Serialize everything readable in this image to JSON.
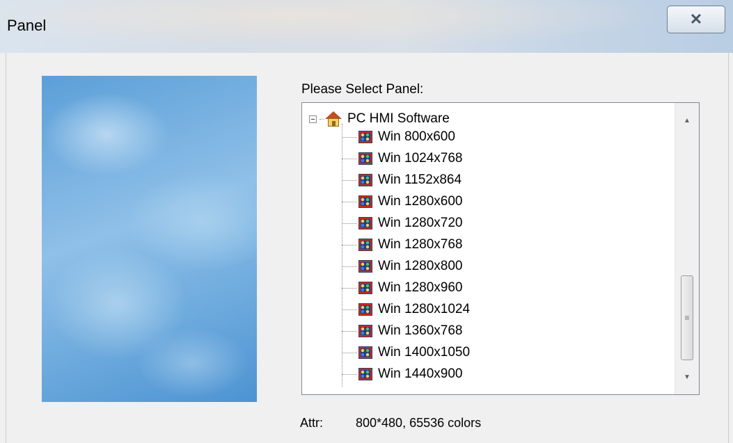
{
  "window": {
    "title": "Panel",
    "close_glyph": "✕"
  },
  "prompt": "Please Select Panel:",
  "tree": {
    "root": {
      "label": "PC HMI Software",
      "icon": "home-icon",
      "expander": "−"
    },
    "items": [
      {
        "label": "Win 800x600"
      },
      {
        "label": "Win 1024x768"
      },
      {
        "label": "Win 1152x864"
      },
      {
        "label": "Win 1280x600"
      },
      {
        "label": "Win 1280x720"
      },
      {
        "label": "Win 1280x768"
      },
      {
        "label": "Win 1280x800"
      },
      {
        "label": "Win 1280x960"
      },
      {
        "label": "Win 1280x1024"
      },
      {
        "label": "Win 1360x768"
      },
      {
        "label": "Win 1400x1050"
      },
      {
        "label": "Win 1440x900"
      }
    ],
    "scrollbar": {
      "up": "▲",
      "down": "▼",
      "grip": "≡"
    }
  },
  "attr": {
    "label": "Attr:",
    "value": "800*480, 65536 colors"
  }
}
